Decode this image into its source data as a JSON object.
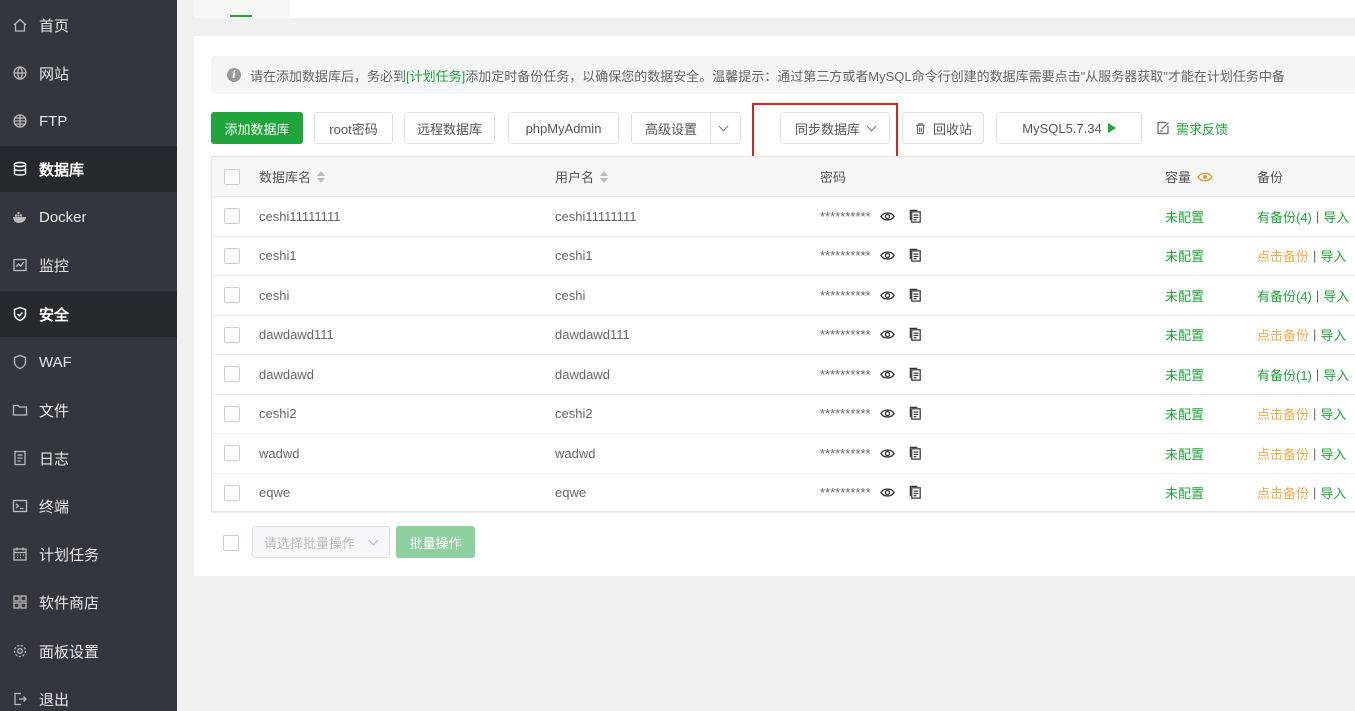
{
  "sidebar": {
    "items": [
      {
        "label": "首页",
        "icon": "home-icon"
      },
      {
        "label": "网站",
        "icon": "globe-icon"
      },
      {
        "label": "FTP",
        "icon": "ftp-globe-icon"
      },
      {
        "label": "数据库",
        "icon": "database-icon",
        "active": true
      },
      {
        "label": "Docker",
        "icon": "docker-icon"
      },
      {
        "label": "监控",
        "icon": "monitor-icon"
      },
      {
        "label": "安全",
        "icon": "shield-icon",
        "active": true
      },
      {
        "label": "WAF",
        "icon": "waf-shield-icon"
      },
      {
        "label": "文件",
        "icon": "folder-icon"
      },
      {
        "label": "日志",
        "icon": "log-icon"
      },
      {
        "label": "终端",
        "icon": "terminal-icon"
      },
      {
        "label": "计划任务",
        "icon": "calendar-icon"
      },
      {
        "label": "软件商店",
        "icon": "apps-grid-icon"
      },
      {
        "label": "面板设置",
        "icon": "gear-icon"
      },
      {
        "label": "退出",
        "icon": "logout-icon"
      }
    ]
  },
  "notice": {
    "prefix": "请在添加数据库后，务必到",
    "link": "[计划任务]",
    "suffix": "添加定时备份任务，以确保您的数据安全。温馨提示：通过第三方或者MySQL命令行创建的数据库需要点击\"从服务器获取\"才能在计划任务中备"
  },
  "toolbar": {
    "add_db": "添加数据库",
    "root_pw": "root密码",
    "remote_db": "远程数据库",
    "phpmyadmin": "phpMyAdmin",
    "advanced": "高级设置",
    "sync_db": "同步数据库",
    "recycle": "回收站",
    "mysql_version": "MySQL5.7.34",
    "feedback": "需求反馈"
  },
  "table": {
    "headers": {
      "name": "数据库名",
      "user": "用户名",
      "password": "密码",
      "capacity": "容量",
      "backup": "备份"
    },
    "rows": [
      {
        "name": "ceshi11111111",
        "user": "ceshi11111111",
        "password": "**********",
        "capacity": "未配置",
        "backup": "有备份(4)",
        "backup_state": "has",
        "import": "导入"
      },
      {
        "name": "ceshi1",
        "user": "ceshi1",
        "password": "**********",
        "capacity": "未配置",
        "backup": "点击备份",
        "backup_state": "none",
        "import": "导入"
      },
      {
        "name": "ceshi",
        "user": "ceshi",
        "password": "**********",
        "capacity": "未配置",
        "backup": "有备份(4)",
        "backup_state": "has",
        "import": "导入"
      },
      {
        "name": "dawdawd111",
        "user": "dawdawd111",
        "password": "**********",
        "capacity": "未配置",
        "backup": "点击备份",
        "backup_state": "none",
        "import": "导入"
      },
      {
        "name": "dawdawd",
        "user": "dawdawd",
        "password": "**********",
        "capacity": "未配置",
        "backup": "有备份(1)",
        "backup_state": "has",
        "import": "导入"
      },
      {
        "name": "ceshi2",
        "user": "ceshi2",
        "password": "**********",
        "capacity": "未配置",
        "backup": "点击备份",
        "backup_state": "none",
        "import": "导入"
      },
      {
        "name": "wadwd",
        "user": "wadwd",
        "password": "**********",
        "capacity": "未配置",
        "backup": "点击备份",
        "backup_state": "none",
        "import": "导入"
      },
      {
        "name": "eqwe",
        "user": "eqwe",
        "password": "**********",
        "capacity": "未配置",
        "backup": "点击备份",
        "backup_state": "none",
        "import": "导入"
      }
    ]
  },
  "batch": {
    "select_placeholder": "请选择批量操作",
    "button": "批量操作"
  },
  "colors": {
    "accent": "#20a53a",
    "warning": "#f0ad4e",
    "highlight": "#e02020",
    "sidebar_bg": "#33373d"
  }
}
